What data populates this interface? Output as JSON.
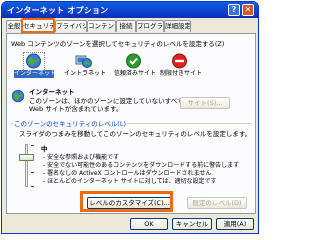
{
  "window": {
    "title": "インターネット オプション",
    "help_label": "?",
    "close_label": "✕"
  },
  "tabs": [
    {
      "label": "全般",
      "active": false
    },
    {
      "label": "セキュリティ",
      "active": true
    },
    {
      "label": "プライバシー",
      "active": false
    },
    {
      "label": "コンテンツ",
      "active": false
    },
    {
      "label": "接続",
      "active": false
    },
    {
      "label": "プログラム",
      "active": false
    },
    {
      "label": "詳細設定",
      "active": false
    }
  ],
  "security": {
    "prompt": "Web コンテンツのゾーンを選択してセキュリティのレベルを設定する(Z)",
    "zones": [
      {
        "label": "インターネット",
        "icon": "globe-icon",
        "selected": true
      },
      {
        "label": "イントラネット",
        "icon": "intranet-icon",
        "selected": false
      },
      {
        "label": "信頼済みサイト",
        "icon": "check-icon",
        "selected": false
      },
      {
        "label": "制限付きサイト",
        "icon": "no-entry-icon",
        "selected": false
      }
    ],
    "zone_title": "インターネット",
    "zone_desc_line1": "このゾーンは、ほかのゾーンに設定していないすべての",
    "zone_desc_line2": "Web サイトが含まれています。",
    "sites_button": "サイト(S)..."
  },
  "level": {
    "legend": "このゾーンのセキュリティのレベル(L)",
    "hint": "スライダのつまみを移動してこのゾーンのセキュリティのレベルを設定します。",
    "level_name": "中",
    "bullets": [
      "- 安全な参照および機能です",
      "- 安全でない可能性のあるコンテンツをダウンロードする前に警告します",
      "- 署名なしの ActiveX コントロールはダウンロードされません",
      "- ほとんどのインターネット サイトに対しては、適切な設定です"
    ],
    "custom_button": "レベルのカスタマイズ(C)...",
    "default_button": "既定のレベル(D)"
  },
  "footer": {
    "ok": "OK",
    "cancel": "キャンセル",
    "apply": "適用(A)"
  },
  "colors": {
    "titlebar": "#0a5fe0",
    "highlight": "#f26a10",
    "legend_text": "#0046d5"
  }
}
